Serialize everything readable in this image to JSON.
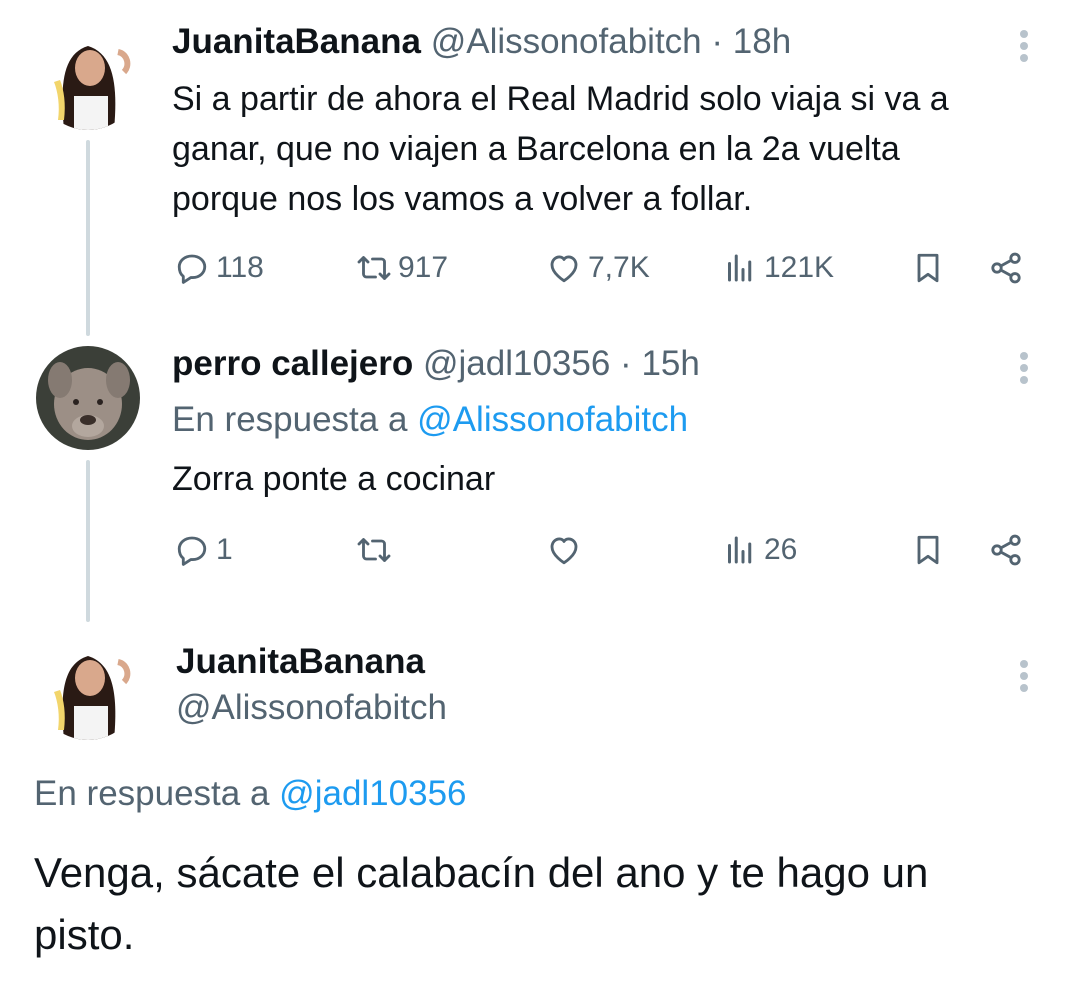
{
  "tweet1": {
    "display_name": "JuanitaBanana",
    "handle": "@Alissonofabitch",
    "separator": "·",
    "time": "18h",
    "text_lines": [
      "Si a partir de ahora el Real Madrid solo viaja si va a",
      "ganar, que no viajen a Barcelona en la 2a vuelta",
      "porque nos los vamos a volver a follar."
    ],
    "replies": "118",
    "retweets": "917",
    "likes": "7,7K",
    "views": "121K"
  },
  "tweet2": {
    "display_name": "perro callejero",
    "handle": "@jadl10356",
    "separator": "·",
    "time": "15h",
    "reply_prefix": "En respuesta a",
    "reply_to": "@Alissonofabitch",
    "text": "Zorra ponte a cocinar",
    "replies": "1",
    "views": "26"
  },
  "tweet3": {
    "display_name": "JuanitaBanana",
    "handle": "@Alissonofabitch",
    "reply_prefix": "En respuesta a",
    "reply_to": "@jadl10356",
    "text_lines": [
      "Venga, sácate el calabacín del ano y te hago un",
      "pisto."
    ]
  },
  "icons": {
    "reply": "reply-icon",
    "retweet": "retweet-icon",
    "like": "heart-icon",
    "views": "views-icon",
    "bookmark": "bookmark-icon",
    "share": "share-icon",
    "more": "more-icon"
  },
  "colors": {
    "text": "#0f1419",
    "muted": "#536471",
    "link": "#1d9bf0",
    "thread_line": "#cfd9de"
  }
}
